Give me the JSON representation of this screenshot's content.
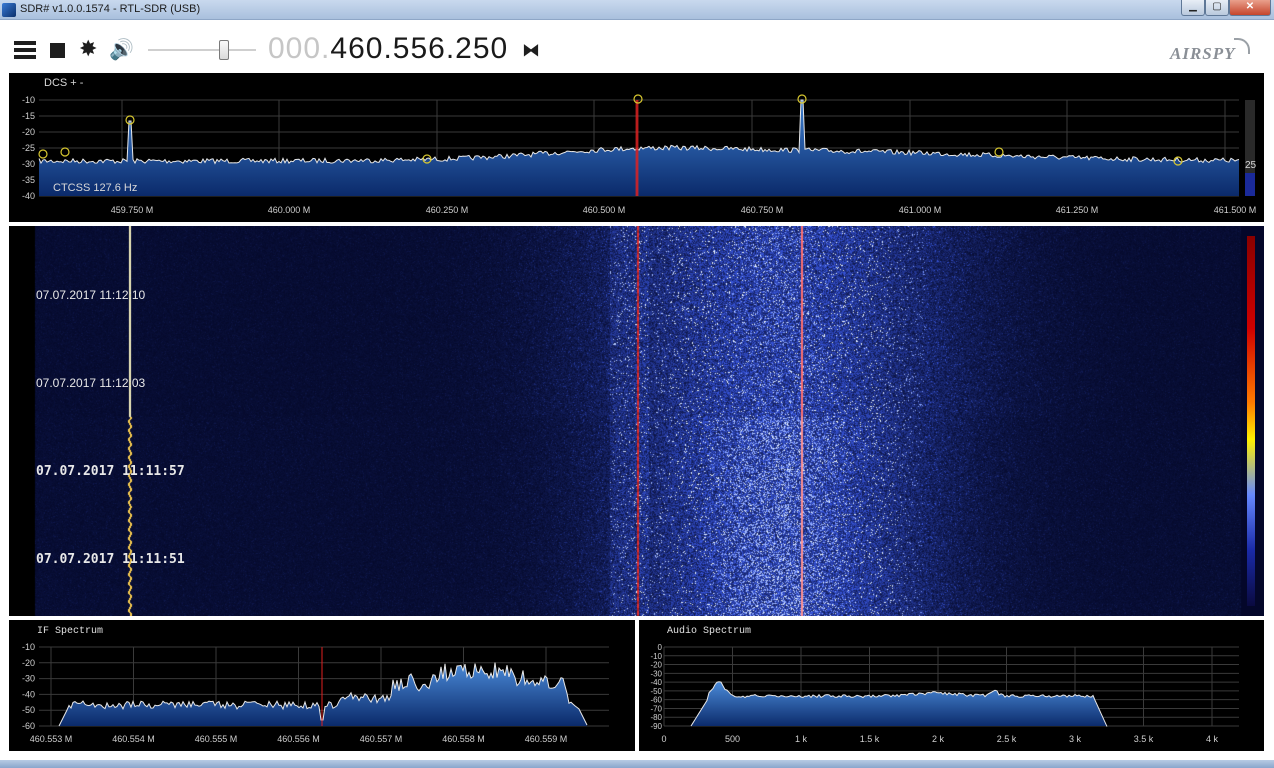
{
  "window": {
    "title": "SDR# v1.0.0.1574 - RTL-SDR (USB)",
    "minimize": "▁",
    "maximize": "▢",
    "close": "✕"
  },
  "toolbar": {
    "menu_icon": "hamburger-menu-icon",
    "stop_icon": "stop-icon",
    "settings_icon": "gear-icon",
    "audio_icon": "speaker-icon",
    "gear_glyph": "✸",
    "speaker_glyph": "🔊",
    "volume_level": 0.72,
    "frequency_prefix": "000.",
    "frequency_main": "460.556.250",
    "tune_icon": "swap-arrows-icon",
    "tune_glyph": "⧓",
    "logo": "AIRSPY"
  },
  "spectrum": {
    "dcs_label": "DCS + -",
    "ctcss_label": "CTCSS  127.6 Hz",
    "y_ticks": [
      "-10",
      "-15",
      "-20",
      "-25",
      "-30",
      "-35",
      "-40"
    ],
    "x_ticks": [
      "459.750 M",
      "460.000 M",
      "460.250 M",
      "460.500 M",
      "460.750 M",
      "461.000 M",
      "461.250 M",
      "461.500 M"
    ],
    "contrast_value": "25",
    "colors": {
      "fill": "#1f5fae",
      "trace": "#ffffff",
      "marker": "#d8c830",
      "tuned_line": "#e02020"
    }
  },
  "waterfall": {
    "timestamps": [
      {
        "label": "07.07.2017 11:12:10",
        "bold": false
      },
      {
        "label": "07.07.2017 11:12:03",
        "bold": false
      },
      {
        "label": "07.07.2017 11:11:57",
        "bold": true
      },
      {
        "label": "07.07.2017 11:11:51",
        "bold": true
      }
    ]
  },
  "if_spectrum": {
    "title": "IF Spectrum",
    "y_ticks": [
      "-10",
      "-20",
      "-30",
      "-40",
      "-50",
      "-60"
    ],
    "x_ticks": [
      "460.553 M",
      "460.554 M",
      "460.555 M",
      "460.556 M",
      "460.557 M",
      "460.558 M",
      "460.559 M"
    ]
  },
  "audio_spectrum": {
    "title": "Audio Spectrum",
    "y_ticks": [
      "0",
      "-10",
      "-20",
      "-30",
      "-40",
      "-50",
      "-60",
      "-70",
      "-80",
      "-90"
    ],
    "x_ticks": [
      "0",
      "500",
      "1 k",
      "1.5 k",
      "2 k",
      "2.5 k",
      "3 k",
      "3.5 k",
      "4 k"
    ]
  }
}
